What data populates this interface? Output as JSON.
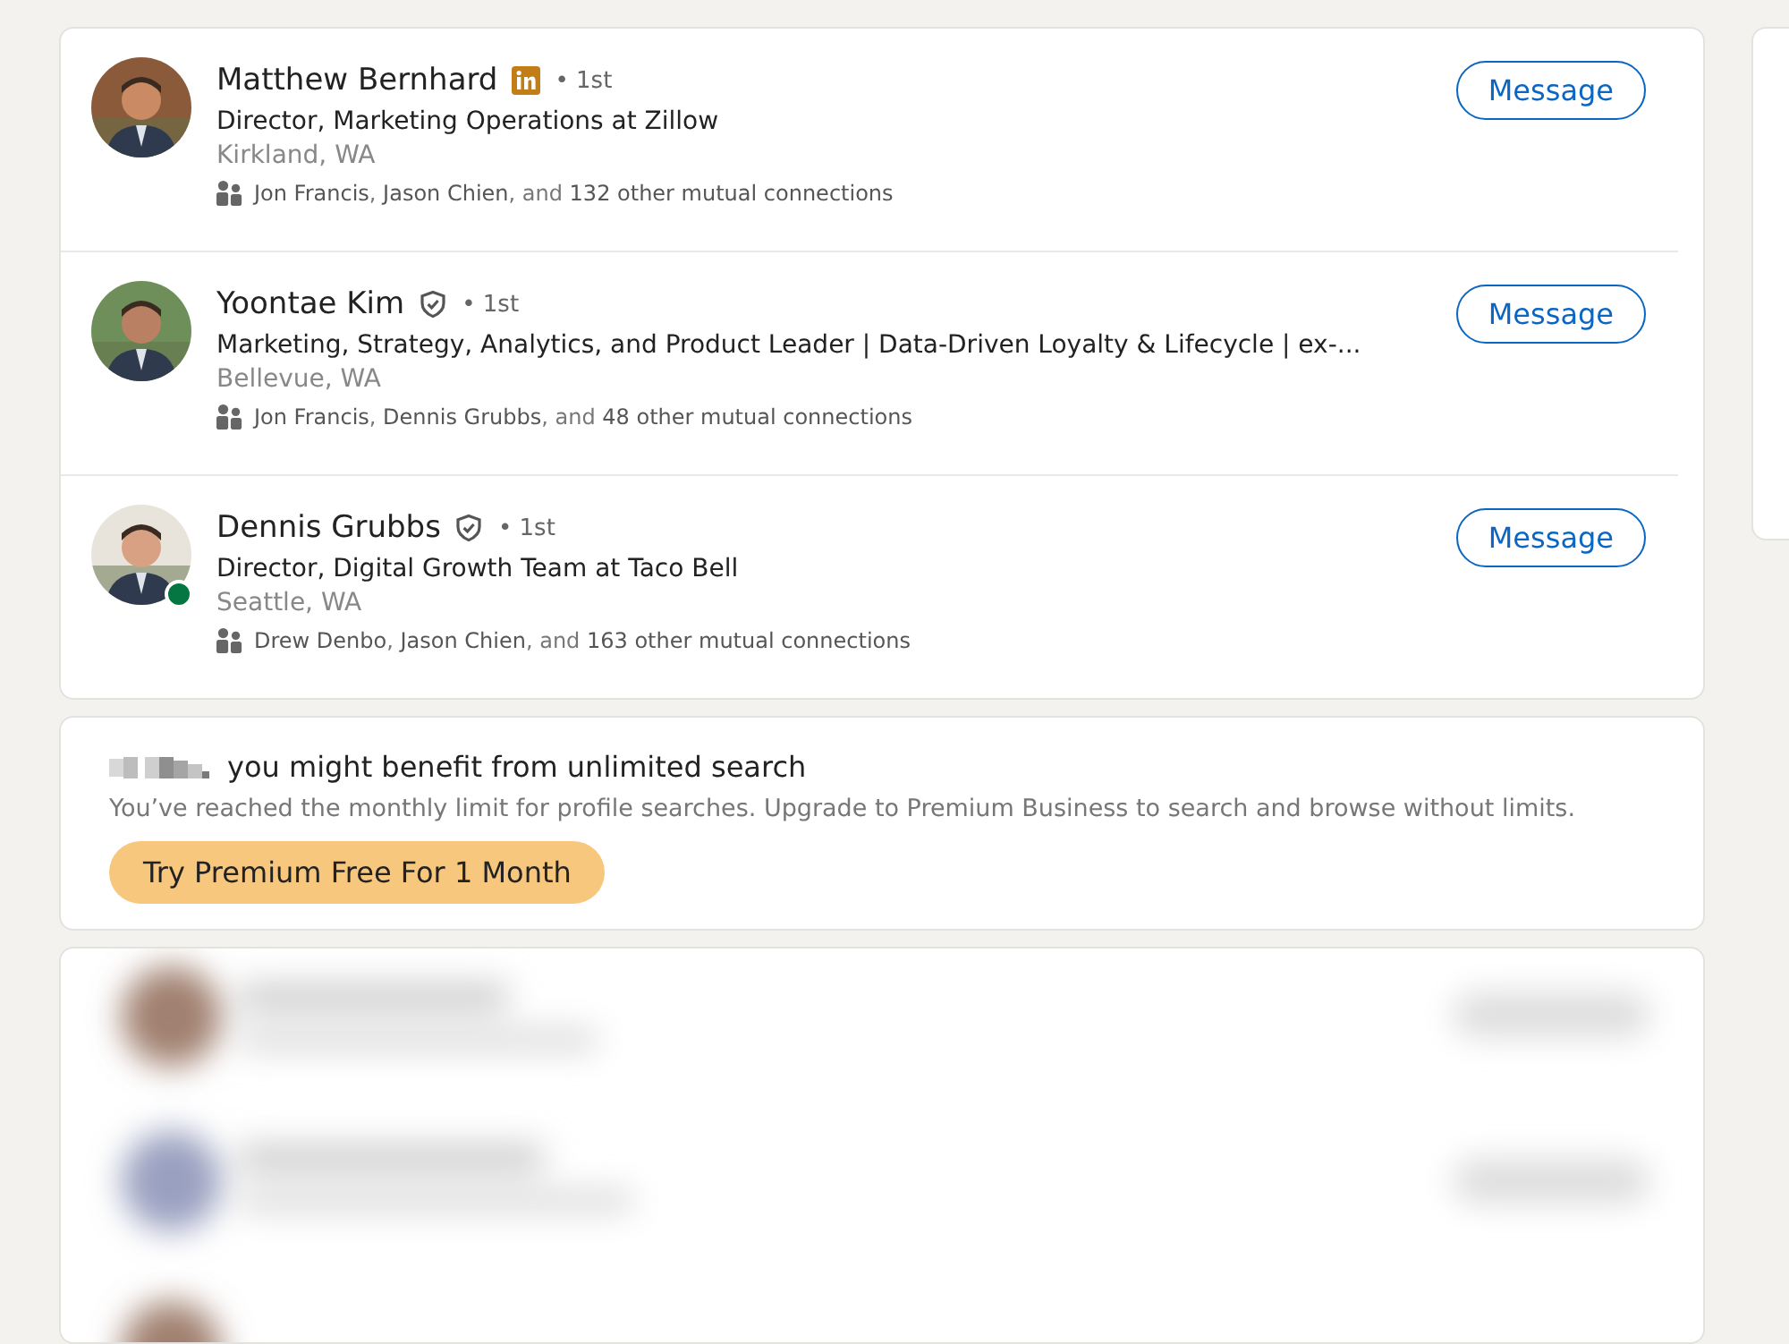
{
  "people": [
    {
      "name": "Matthew Bernhard",
      "kind": "linkedin",
      "degree": "• 1st",
      "headline": "Director, Marketing Operations at Zillow",
      "location": "Kirkland, WA",
      "mutual": "**Jon Francis**, **Jason Chien**, and **132 other mutual connections**",
      "online": false,
      "button": "Message"
    },
    {
      "name": "Yoontae Kim",
      "kind": "verified",
      "degree": "• 1st",
      "headline": "Marketing, Strategy, Analytics, and Product Leader | Data-Driven Loyalty & Lifecycle | ex-...",
      "location": "Bellevue, WA",
      "mutual": "**Jon Francis**, **Dennis Grubbs**, and **48 other mutual connections**",
      "online": false,
      "button": "Message"
    },
    {
      "name": "Dennis Grubbs",
      "kind": "verified",
      "degree": "• 1st",
      "headline": "Director, Digital Growth Team at Taco Bell",
      "location": "Seattle, WA",
      "mutual": "**Drew Denbo**, **Jason Chien**, and **163 other mutual connections**",
      "online": true,
      "button": "Message"
    }
  ],
  "promo": {
    "title": "you might benefit from unlimited search",
    "text": "You’ve reached the monthly limit for profile searches. Upgrade to Premium Business to search and browse without limits.",
    "button": "Try Premium Free For 1 Month"
  }
}
